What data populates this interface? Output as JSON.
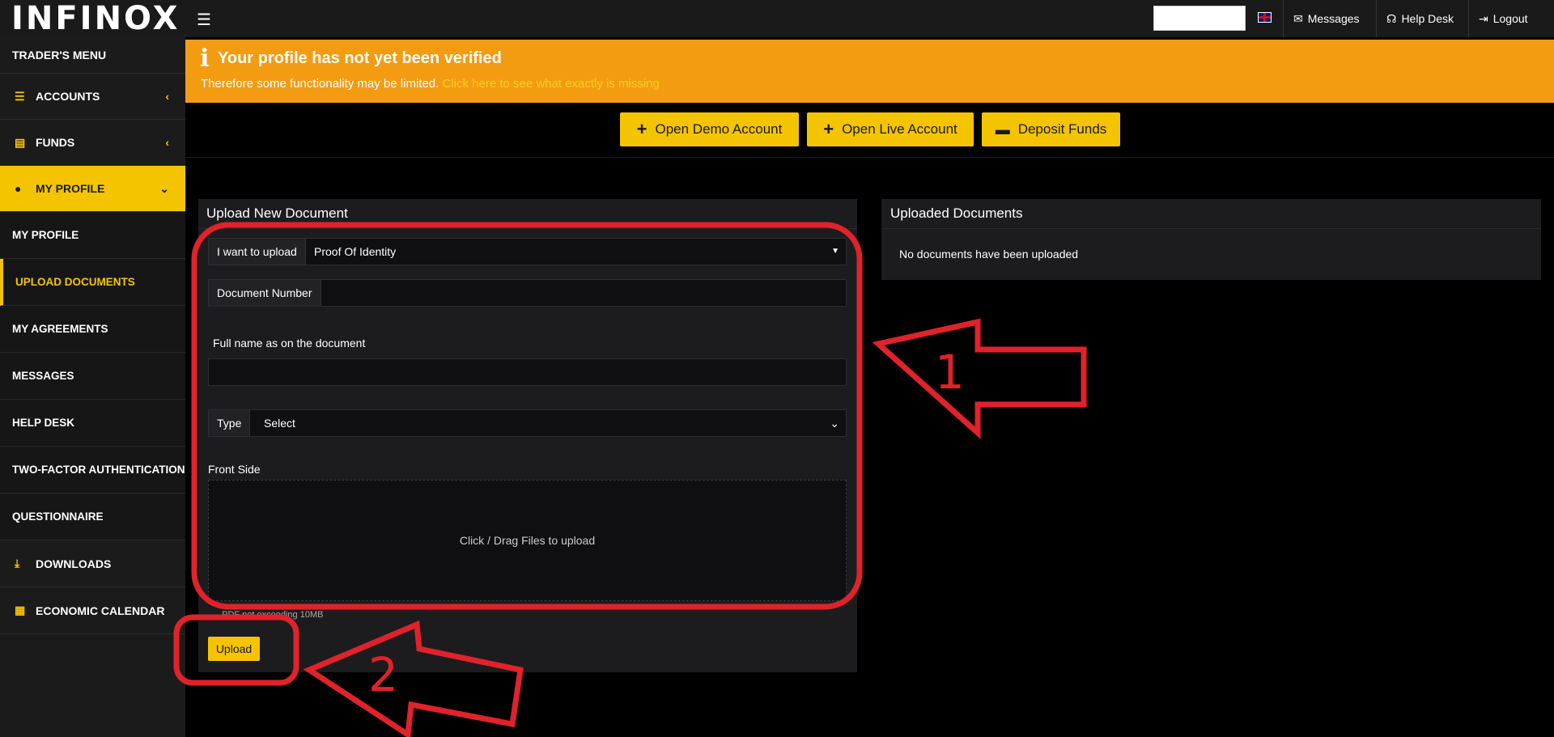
{
  "header": {
    "logo": "INFINOX",
    "menu_icon": "hamburger-icon",
    "nav": [
      {
        "label": "Messages",
        "icon": "envelope-icon"
      },
      {
        "label": "Help Desk",
        "icon": "headset-icon"
      },
      {
        "label": "Logout",
        "icon": "logout-icon"
      }
    ]
  },
  "sidebar": {
    "heading": "TRADER'S MENU",
    "accounts": "ACCOUNTS",
    "funds": "FUNDS",
    "my_profile": "MY PROFILE",
    "sub": [
      "MY PROFILE",
      "UPLOAD DOCUMENTS",
      "MY AGREEMENTS",
      "MESSAGES",
      "HELP DESK",
      "TWO-FACTOR AUTHENTICATION",
      "QUESTIONNAIRE"
    ],
    "downloads": "DOWNLOADS",
    "economic_calendar": "ECONOMIC CALENDAR"
  },
  "banner": {
    "title": "Your profile has not yet been verified",
    "text": "Therefore some functionality may be limited.",
    "link": "Click here to see what exactly is missing"
  },
  "actions": {
    "demo": "Open Demo Account",
    "live": "Open Live Account",
    "deposit": "Deposit Funds"
  },
  "upload": {
    "title": "Upload New Document",
    "i_want_label": "I want to upload",
    "doc_type_value": "Proof Of Identity",
    "doc_number_label": "Document Number",
    "doc_number_value": "",
    "full_name_label": "Full name as on the document",
    "full_name_value": "",
    "type_label": "Type",
    "type_value": "Select",
    "front_side_label": "Front Side",
    "dropzone_text": "Click / Drag Files to upload",
    "hint": "…, PDF not exceeding 10MB",
    "upload_button": "Upload"
  },
  "uploaded": {
    "title": "Uploaded Documents",
    "empty": "No documents have been uploaded"
  },
  "annotations": {
    "one": "1",
    "two": "2",
    "color": "#e0222b"
  },
  "colors": {
    "accent": "#f5c400",
    "banner": "#f39c12"
  }
}
